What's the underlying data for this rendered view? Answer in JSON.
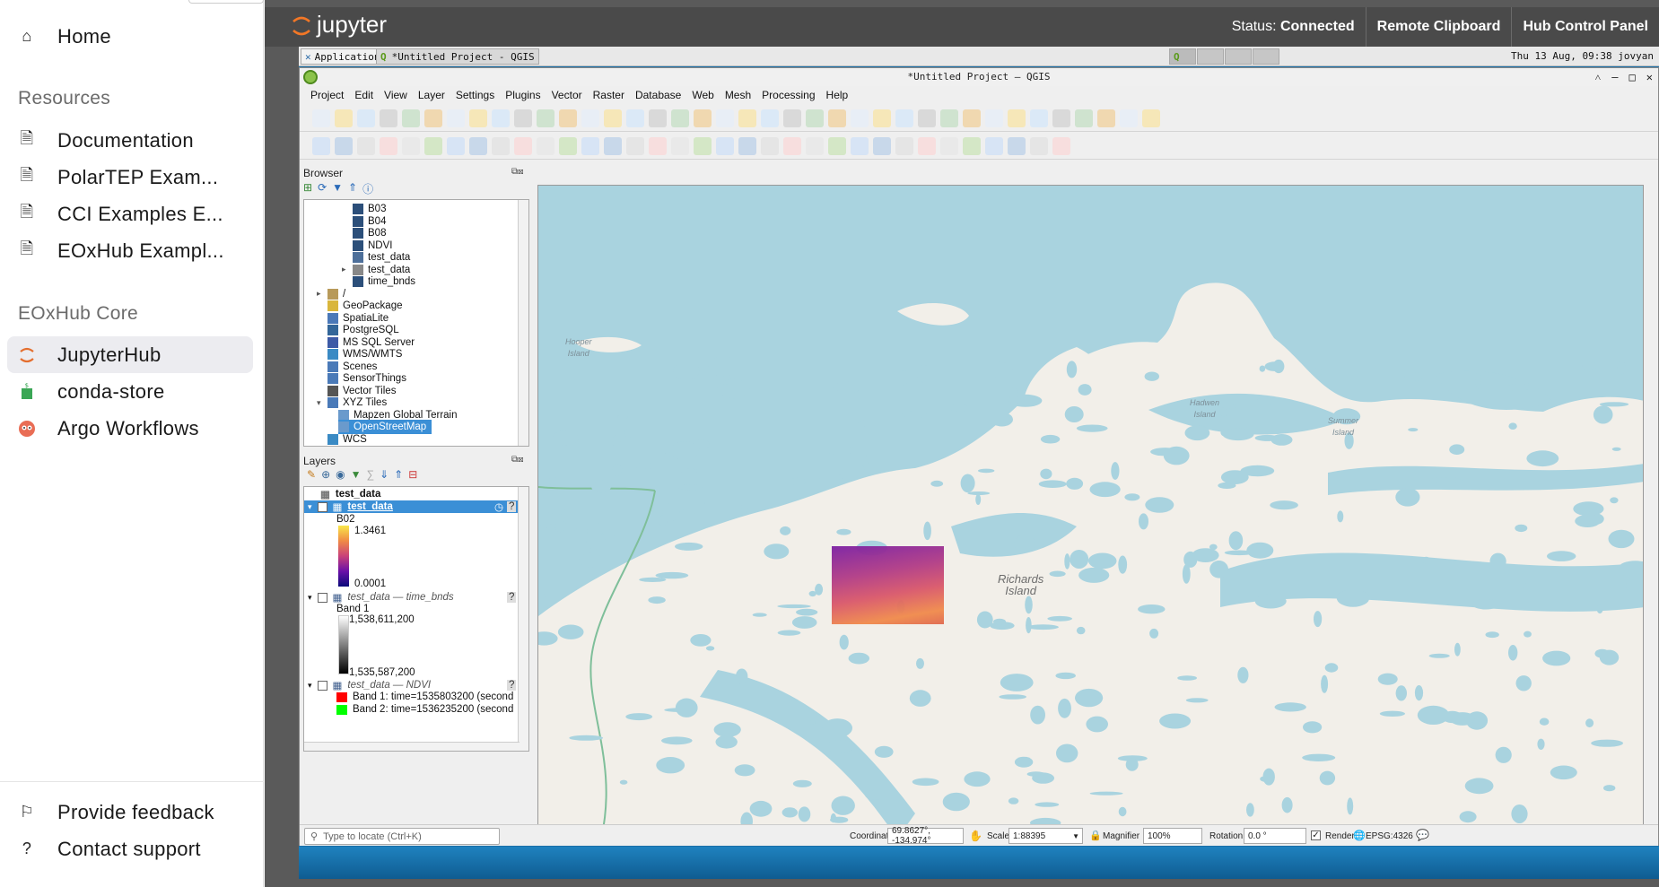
{
  "sidebar": {
    "home": "Home",
    "resources_heading": "Resources",
    "resources": [
      "Documentation",
      "PolarTEP Exam...",
      "CCI Examples E...",
      "EOxHub Exampl..."
    ],
    "core_heading": "EOxHub Core",
    "core": [
      "JupyterHub",
      "conda-store",
      "Argo Workflows"
    ],
    "feedback": "Provide feedback",
    "support": "Contact support"
  },
  "jupyter": {
    "logo": "jupyter",
    "status_label": "Status:",
    "status_value": "Connected",
    "remote_clipboard": "Remote Clipboard",
    "hub_control_panel": "Hub Control Panel"
  },
  "taskbar": {
    "applications": "Applications",
    "window": "*Untitled Project - QGIS",
    "clock": "Thu 13 Aug, 09:38",
    "user": "jovyan"
  },
  "qgis": {
    "title": "*Untitled Project — QGIS",
    "menu": [
      "Project",
      "Edit",
      "View",
      "Layer",
      "Settings",
      "Plugins",
      "Vector",
      "Raster",
      "Database",
      "Web",
      "Mesh",
      "Processing",
      "Help"
    ],
    "browser_title": "Browser",
    "browser_items": [
      "B03",
      "B04",
      "B08",
      "NDVI",
      "test_data",
      "test_data",
      "time_bnds",
      "/",
      "GeoPackage",
      "SpatiaLite",
      "PostgreSQL",
      "MS SQL Server",
      "WMS/WMTS",
      "Scenes",
      "SensorThings",
      "Vector Tiles",
      "XYZ Tiles",
      "Mapzen Global Terrain",
      "OpenStreetMap",
      "WCS"
    ],
    "layers_title": "Layers",
    "layers": {
      "l1": "test_data",
      "l2": "test_data",
      "band_b02": "B02",
      "b02_max": "1.3461",
      "b02_min": "0.0001",
      "l3": "test_data — time_bnds",
      "band1": "Band 1",
      "tb_max": "1,538,611,200",
      "tb_min": "1,535,587,200",
      "l4": "test_data — NDVI",
      "ndvi_b1": "Band 1: time=1535803200 (second",
      "ndvi_b2": "Band 2: time=1536235200 (second"
    },
    "map_labels": {
      "hooper": "Hooper\nIsland",
      "hadwen": "Hadwen\nIsland",
      "summer": "Summer\nIsland",
      "richards": "Richards\nIsland"
    },
    "status": {
      "locate_placeholder": "Type to locate (Ctrl+K)",
      "coordinate_label": "Coordinate",
      "coordinate": "69.8627°, -134.974°",
      "scale_label": "Scale",
      "scale": "1:88395",
      "magnifier_label": "Magnifier",
      "magnifier": "100%",
      "rotation_label": "Rotation",
      "rotation": "0.0 °",
      "render_label": "Render",
      "crs": "EPSG:4326"
    }
  }
}
